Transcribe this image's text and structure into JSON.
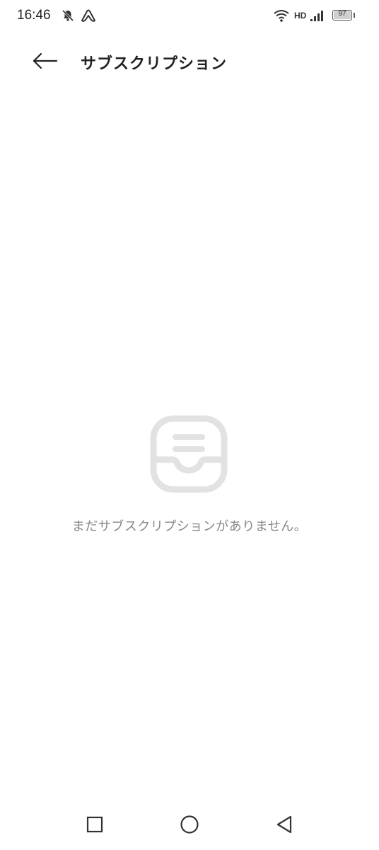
{
  "status_bar": {
    "time": "16:46",
    "network": "HD",
    "battery_level": "97",
    "icons": [
      "bell-muted-icon",
      "app-notification-icon",
      "wifi-icon",
      "signal-icon",
      "battery-icon"
    ]
  },
  "app_bar": {
    "back_icon": "arrow-left-icon",
    "title": "サブスクリプション"
  },
  "empty_state": {
    "icon": "inbox-tray-icon",
    "message": "まだサブスクリプションがありません。"
  },
  "nav_bar": {
    "icons": [
      "recent-apps-square-icon",
      "home-circle-icon",
      "back-triangle-icon"
    ]
  },
  "colors": {
    "background": "#ffffff",
    "title_text": "#222222",
    "empty_text": "#888888",
    "empty_icon": "#e2e2e2"
  }
}
